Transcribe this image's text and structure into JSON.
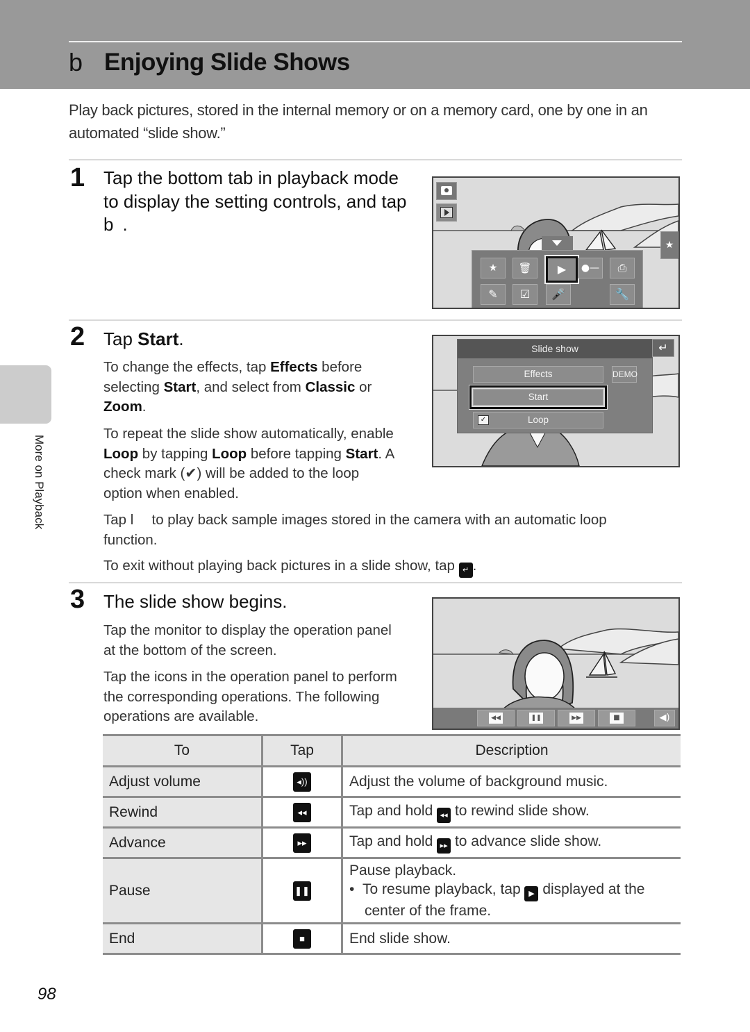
{
  "header": {
    "chapter_glyph": "b",
    "title": "Enjoying Slide Shows"
  },
  "intro": "Play back pictures, stored in the internal memory or on a memory card, one by one in an automated “slide show.”",
  "steps": [
    {
      "number": "1",
      "title": "Tap the bottom tab in playback mode to display the setting controls, and tap b ."
    },
    {
      "number": "2",
      "title_prefix": "Tap ",
      "title_bold": "Start",
      "title_suffix": ".",
      "para1": {
        "t1": "To change the effects, tap ",
        "b1": "Effects",
        "t2": " before selecting ",
        "b2": "Start",
        "t3": ", and select from ",
        "b3": "Classic",
        "t4": " or ",
        "b4": "Zoom",
        "t5": "."
      },
      "para2": {
        "t1": "To repeat the slide show automatically, enable ",
        "b1": "Loop",
        "t2": " by tapping ",
        "b2": "Loop",
        "t3": " before tapping ",
        "b3": "Start",
        "t4": ". A check mark (",
        "check": "✔",
        "t5": ") will be added to the loop option when enabled."
      },
      "para3": "Tap l   to play back sample images stored in the camera with an automatic loop function.",
      "para4_prefix": "To exit without playing back pictures in a slide show, tap ",
      "para4_icon": "↵",
      "para4_suffix": "."
    },
    {
      "number": "3",
      "title": "The slide show begins.",
      "para1": "Tap the monitor to display the operation panel at the bottom of the screen.",
      "para2": "Tap the icons in the operation panel to perform the corresponding operations. The following operations are available."
    }
  ],
  "screen1": {
    "left_icons": [
      "camera-mode",
      "playback-mode"
    ],
    "side_tab_icon": "★",
    "menu_icons_row1": [
      "favorite-folder",
      "delete",
      "slide-show",
      "protect",
      "print-order"
    ],
    "menu_icons_row2": [
      "retouch",
      "paint",
      "voice-memo",
      "",
      "setup"
    ],
    "selected": "slide-show"
  },
  "screen2": {
    "menu_title": "Slide show",
    "effects_label": "Effects",
    "start_label": "Start",
    "loop_label": "Loop",
    "loop_checked": true,
    "demo_label": "DEMO",
    "back_icon": "↵"
  },
  "screen3": {
    "controls": [
      "◀◀",
      "❚❚",
      "▶▶",
      "■"
    ],
    "volume_icon": "🔊"
  },
  "table": {
    "headers": [
      "To",
      "Tap",
      "Description"
    ],
    "rows": [
      {
        "to": "Adjust volume",
        "icon": "◂))",
        "icon_name": "volume-icon",
        "desc": "Adjust the volume of background music."
      },
      {
        "to": "Rewind",
        "icon": "◂◂",
        "icon_name": "rewind-icon",
        "desc_prefix": "Tap and hold ",
        "desc_icon": "◂◂",
        "desc_suffix": " to rewind slide show."
      },
      {
        "to": "Advance",
        "icon": "▸▸",
        "icon_name": "advance-icon",
        "desc_prefix": "Tap and hold ",
        "desc_icon": "▸▸",
        "desc_suffix": " to advance slide show."
      },
      {
        "to": "Pause",
        "icon": "❚❚",
        "icon_name": "pause-icon",
        "desc": "Pause playback.",
        "bullet_prefix": "To resume playback, tap ",
        "bullet_icon": "▶",
        "bullet_suffix": " displayed at the center of the frame."
      },
      {
        "to": "End",
        "icon": "■",
        "icon_name": "stop-icon",
        "desc": "End slide show."
      }
    ]
  },
  "side_tab": {
    "label": "More on Playback"
  },
  "page_number": "98"
}
